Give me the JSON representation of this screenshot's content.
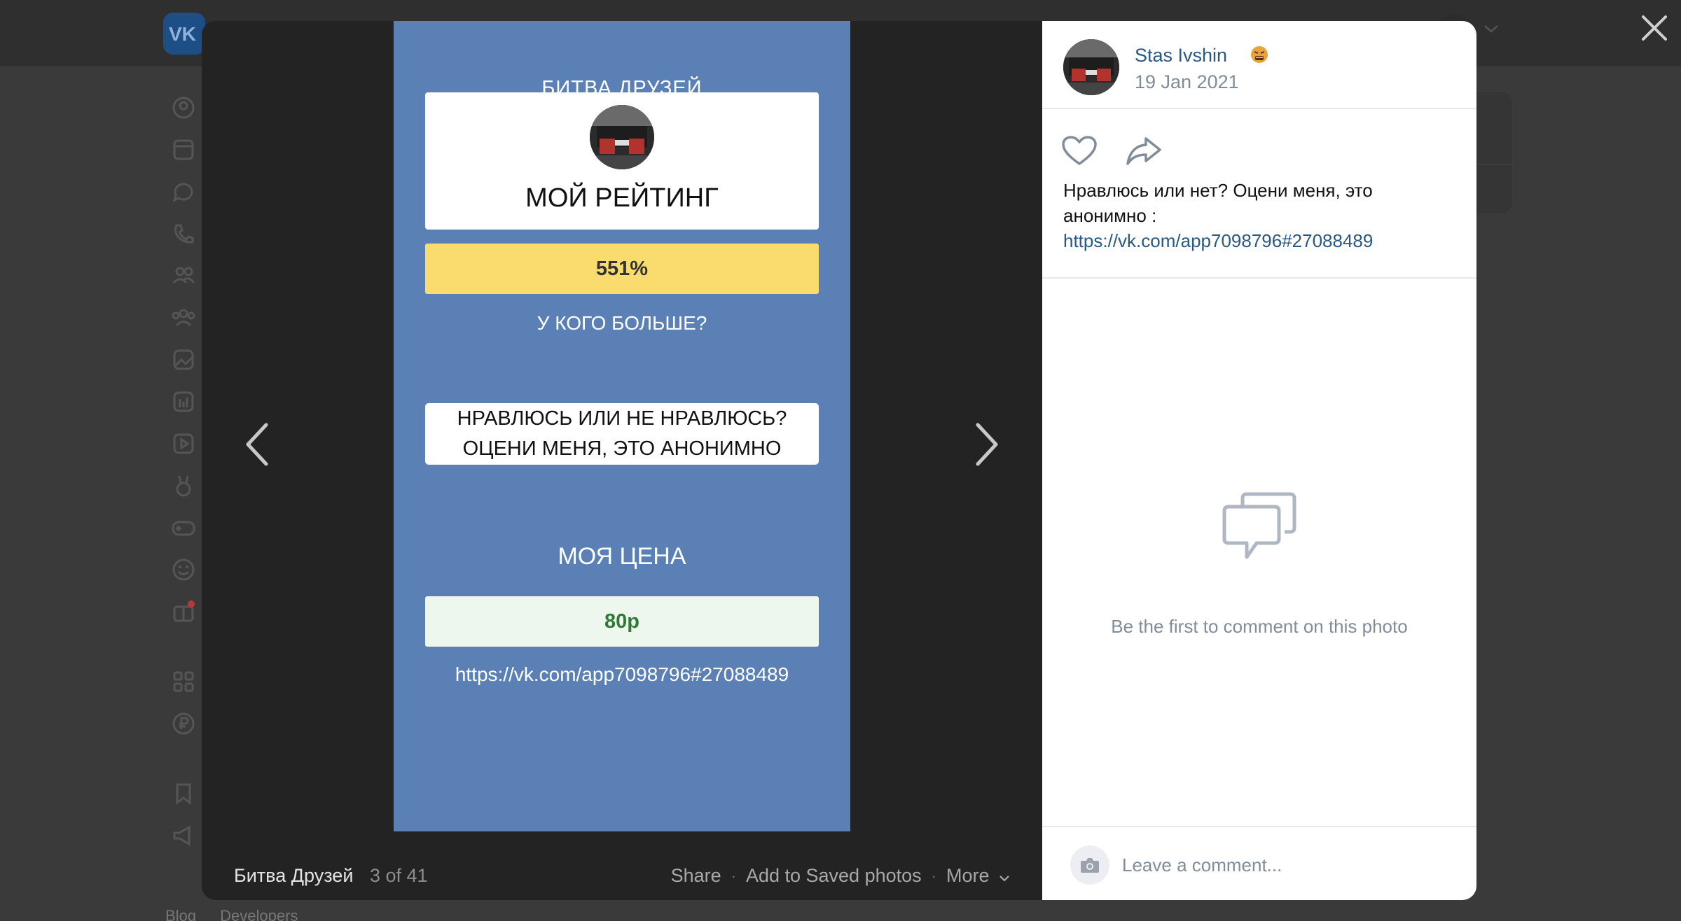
{
  "background": {
    "footer_links": [
      "Blog",
      "Developers"
    ]
  },
  "photo": {
    "app_title": "БИТВА ДРУЗЕЙ",
    "rating_label": "МОЙ РЕЙТИНГ",
    "rating_value": "551%",
    "question": "У КОГО БОЛЬШЕ?",
    "message_line1": "НРАВЛЮСЬ ИЛИ НЕ НРАВЛЮСЬ?",
    "message_line2": "ОЦЕНИ МЕНЯ, ЭТО АНОНИМНО",
    "price_label": "МОЯ ЦЕНА",
    "price_value": "80р",
    "link": "https://vk.com/app7098796#27088489",
    "colors": {
      "background": "#5b80b5",
      "rating_bar": "#f9dc6d",
      "price_bar": "#eef7ee",
      "price_text": "#2f7a35"
    }
  },
  "footer": {
    "album": "Битва Друзей",
    "counter": "3 of 41",
    "actions": {
      "share": "Share",
      "save": "Add to Saved photos",
      "more": "More"
    }
  },
  "post": {
    "author": "Stas Ivshin",
    "emoji_icon": "angry-face-emoji",
    "date": "19 Jan 2021",
    "text": "Нравлюсь или нет? Оцени меня, это анонимно :",
    "link": "https://vk.com/app7098796#27088489"
  },
  "comments": {
    "empty_text": "Be the first to comment on this photo",
    "placeholder": "Leave a comment..."
  },
  "colors": {
    "link": "#2a5885",
    "muted": "#818c99",
    "overlay": "#232323"
  }
}
